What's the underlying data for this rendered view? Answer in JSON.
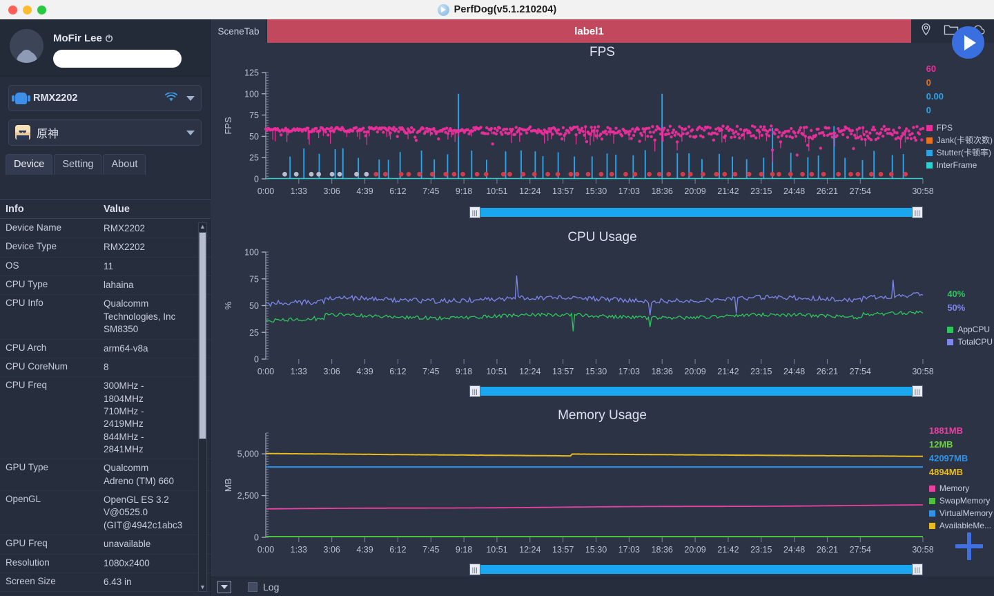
{
  "window": {
    "title": "PerfDog(v5.1.210204)",
    "logo_icon": "perfdog-logo",
    "traffic_lights": [
      "close",
      "minimize",
      "maximize"
    ]
  },
  "sidebar": {
    "user": {
      "name": "MoFir Lee",
      "power_icon": "power-icon",
      "avatar_icon": "user-avatar-icon",
      "redacted_field_value": ""
    },
    "device_select": {
      "value": "RMX2202",
      "platform_icon": "android-icon",
      "connection_icon": "wifi-icon",
      "caret_icon": "chevron-down-icon"
    },
    "app_select": {
      "value": "原神",
      "app_icon": "genshin-app-icon",
      "caret_icon": "chevron-down-icon"
    },
    "tabs": [
      {
        "label": "Device",
        "active": true
      },
      {
        "label": "Setting",
        "active": false
      },
      {
        "label": "About",
        "active": false
      }
    ],
    "table": {
      "headers": [
        "Info",
        "Value"
      ],
      "rows": [
        {
          "key": "Device Name",
          "value": "RMX2202"
        },
        {
          "key": "Device Type",
          "value": "RMX2202"
        },
        {
          "key": "OS",
          "value": "11"
        },
        {
          "key": "CPU Type",
          "value": "lahaina"
        },
        {
          "key": "CPU Info",
          "value": "Qualcomm\nTechnologies, Inc\nSM8350"
        },
        {
          "key": "CPU Arch",
          "value": "arm64-v8a"
        },
        {
          "key": "CPU CoreNum",
          "value": "8"
        },
        {
          "key": "CPU Freq",
          "value": "300MHz -\n1804MHz\n710MHz -\n2419MHz\n844MHz -\n2841MHz"
        },
        {
          "key": "GPU Type",
          "value": "Qualcomm\nAdreno (TM) 660"
        },
        {
          "key": "OpenGL",
          "value": "OpenGL ES 3.2\nV@0525.0\n(GIT@4942c1abc3"
        },
        {
          "key": "GPU Freq",
          "value": "unavailable"
        },
        {
          "key": "Resolution",
          "value": "1080x2400"
        },
        {
          "key": "Screen Size",
          "value": "6.43 in"
        }
      ]
    }
  },
  "scene_bar": {
    "scene_tab_label": "SceneTab",
    "label_tab": "label1",
    "label_tab_color": "#c2485e",
    "icons": [
      "location-pin-icon",
      "folder-icon",
      "cloud-icon"
    ]
  },
  "controls": {
    "play_button": "play-icon",
    "add_button": "plus-icon"
  },
  "bottom_bar": {
    "dropdown_icon": "chevron-down-icon",
    "log_label": "Log",
    "log_checked": false
  },
  "chart_data": [
    {
      "type": "scatter",
      "title": "FPS",
      "xlabel": "",
      "ylabel": "FPS",
      "ylim": [
        0,
        125
      ],
      "yticks": [
        0,
        25,
        50,
        75,
        100,
        125
      ],
      "xticks": [
        "0:00",
        "1:33",
        "3:06",
        "4:39",
        "6:12",
        "7:45",
        "9:18",
        "10:51",
        "12:24",
        "13:57",
        "15:30",
        "17:03",
        "18:36",
        "20:09",
        "21:42",
        "23:15",
        "24:48",
        "26:21",
        "27:54",
        "30:58"
      ],
      "grid": false,
      "legend_position": "right",
      "series": [
        {
          "name": "FPS",
          "color": "#ea2f9b",
          "current_value": "60",
          "mean": 55
        },
        {
          "name": "Jank(卡顿次数)",
          "color": "#e8731c",
          "current_value": "0",
          "mean": 4
        },
        {
          "name": "Stutter(卡顿率)",
          "color": "#2aa3e8",
          "current_value": "0.00",
          "mean": 20
        },
        {
          "name": "InterFrame",
          "color": "#2ecfcf",
          "current_value": "0",
          "mean": 0
        }
      ]
    },
    {
      "type": "line",
      "title": "CPU Usage",
      "xlabel": "",
      "ylabel": "%",
      "ylim": [
        0,
        100
      ],
      "yticks": [
        0,
        25,
        50,
        75,
        100
      ],
      "xticks": [
        "0:00",
        "1:33",
        "3:06",
        "4:39",
        "6:12",
        "7:45",
        "9:18",
        "10:51",
        "12:24",
        "13:57",
        "15:30",
        "17:03",
        "18:36",
        "20:09",
        "21:42",
        "23:15",
        "24:48",
        "26:21",
        "27:54",
        "30:58"
      ],
      "grid": false,
      "legend_position": "right",
      "series": [
        {
          "name": "AppCPU",
          "color": "#2fc55d",
          "current_value": "40%",
          "mean": 40
        },
        {
          "name": "TotalCPU",
          "color": "#7d87ec",
          "current_value": "50%",
          "mean": 56
        }
      ]
    },
    {
      "type": "line",
      "title": "Memory Usage",
      "xlabel": "",
      "ylabel": "MB",
      "ylim": [
        0,
        6250
      ],
      "yticks": [
        0,
        2500,
        5000
      ],
      "xticks": [
        "0:00",
        "1:33",
        "3:06",
        "4:39",
        "6:12",
        "7:45",
        "9:18",
        "10:51",
        "12:24",
        "13:57",
        "15:30",
        "17:03",
        "18:36",
        "20:09",
        "21:42",
        "23:15",
        "24:48",
        "26:21",
        "27:54",
        "30:58"
      ],
      "grid": false,
      "legend_position": "right",
      "series": [
        {
          "name": "Memory",
          "color": "#e8419f",
          "current_value": "1881MB",
          "mean": 1881
        },
        {
          "name": "SwapMemory",
          "color": "#4cc23c",
          "current_value": "12MB",
          "mean": 12
        },
        {
          "name": "VirtualMemory",
          "color": "#2f93e8",
          "current_value": "42097MB",
          "mean": 4220
        },
        {
          "name": "AvailableMe...",
          "color": "#e8bb20",
          "current_value": "4894MB",
          "mean": 4894
        }
      ]
    }
  ]
}
